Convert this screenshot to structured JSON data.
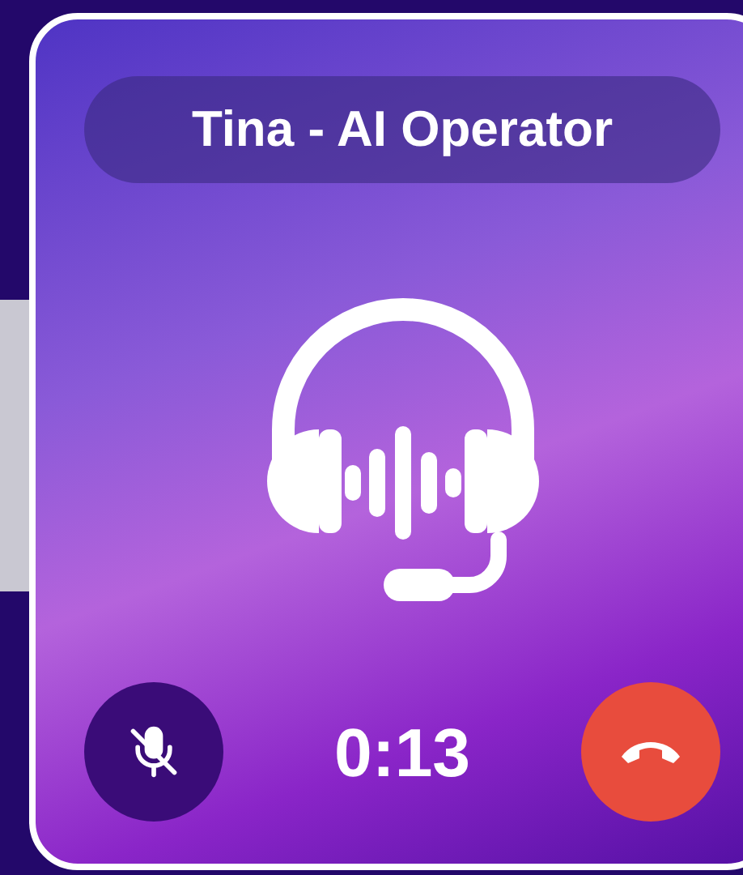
{
  "call": {
    "title": "Tina - AI Operator",
    "timer": "0:13",
    "muted": true
  }
}
